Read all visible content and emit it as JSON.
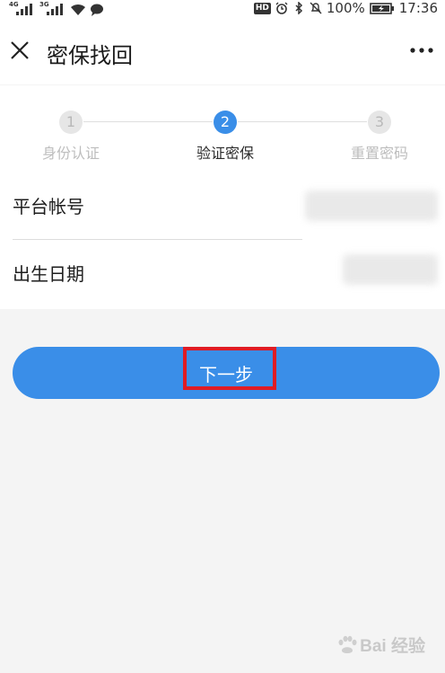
{
  "status_bar": {
    "net_left": "4G",
    "net_right": "3G",
    "hd": "HD",
    "battery_percent": "100%",
    "time": "17:36"
  },
  "nav": {
    "title": "密保找回"
  },
  "steps": [
    {
      "number": "1",
      "label": "身份认证",
      "active": false
    },
    {
      "number": "2",
      "label": "验证密保",
      "active": true
    },
    {
      "number": "3",
      "label": "重置密码",
      "active": false
    }
  ],
  "form": {
    "account_label": "平台帐号",
    "birthdate_label": "出生日期"
  },
  "button": {
    "next_label": "下一步"
  },
  "watermark": {
    "text": "Bai 经验"
  },
  "colors": {
    "accent": "#3a8ee8",
    "highlight": "#e01c24"
  }
}
